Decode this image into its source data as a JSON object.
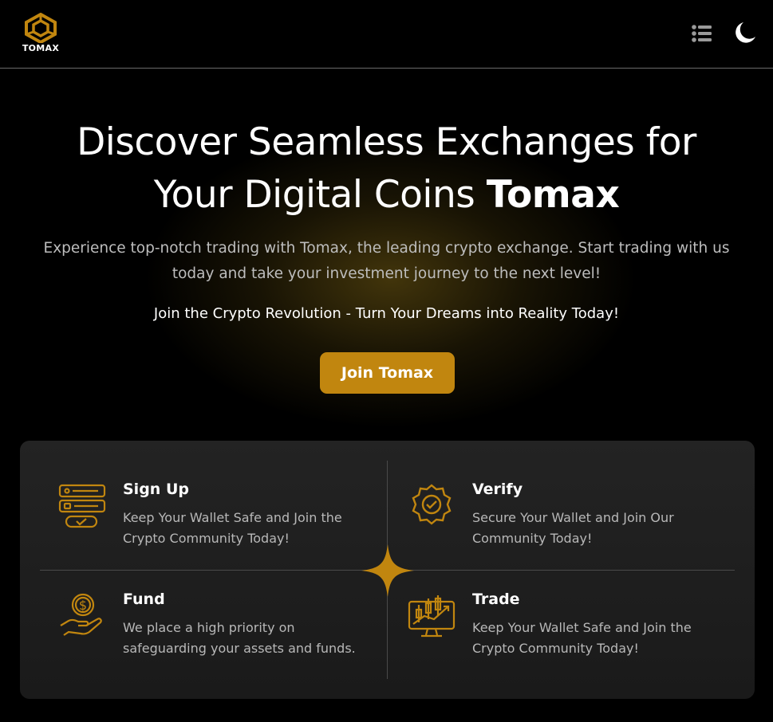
{
  "brand": {
    "name": "TOMAX",
    "accent": "#c1860f"
  },
  "header": {
    "menu_icon": "list-icon",
    "theme_icon": "moon-icon"
  },
  "hero": {
    "title_line1": "Discover Seamless Exchanges for",
    "title_line2_prefix": "Your Digital Coins ",
    "title_line2_bold": "Tomax",
    "subtitle_line1": "Experience top-notch trading with Tomax, the leading crypto exchange. Start trading with us",
    "subtitle_line2": "today and take your investment journey to the next level!",
    "tagline": "Join the Crypto Revolution - Turn Your Dreams into Reality Today!",
    "cta_label": "Join Tomax"
  },
  "features": [
    {
      "icon": "signup-form-icon",
      "title": "Sign Up",
      "line1": "Keep Your Wallet Safe and Join the",
      "line2": "Crypto Community Today!"
    },
    {
      "icon": "verified-badge-icon",
      "title": "Verify",
      "line1": "Secure Your Wallet and Join Our",
      "line2": "Community Today!"
    },
    {
      "icon": "hand-coin-icon",
      "title": "Fund",
      "line1": "We place a high priority on",
      "line2": "safeguarding your assets and funds."
    },
    {
      "icon": "trading-chart-icon",
      "title": "Trade",
      "line1": "Keep Your Wallet Safe and Join the",
      "line2": "Crypto Community Today!"
    }
  ]
}
